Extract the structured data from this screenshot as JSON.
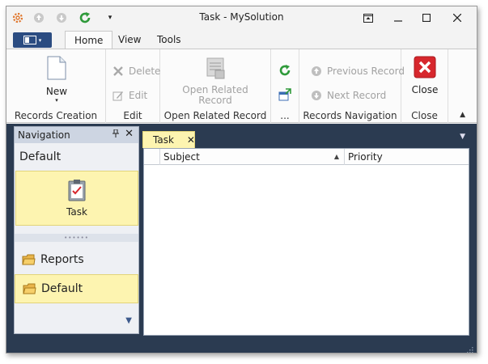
{
  "window": {
    "title": "Task - MySolution"
  },
  "quick_access": [
    "gear-icon",
    "up-circle-icon",
    "down-circle-icon",
    "refresh-icon",
    "customize-icon"
  ],
  "ribbon_tabs": [
    "Home",
    "View",
    "Tools"
  ],
  "ribbon": {
    "records_creation": {
      "label": "Records Creation",
      "new_label": "New"
    },
    "edit": {
      "label": "Edit",
      "delete_label": "Delete",
      "edit_label": "Edit"
    },
    "open_related": {
      "label": "Open Related Record",
      "button_line1": "Open Related",
      "button_line2": "Record"
    },
    "misc": {
      "label": "..."
    },
    "records_navigation": {
      "label": "Records Navigation",
      "previous_label": "Previous Record",
      "next_label": "Next Record"
    },
    "close": {
      "label": "Close",
      "button_label": "Close"
    }
  },
  "navigation": {
    "header": "Navigation",
    "group_title": "Default",
    "big_item": "Task",
    "items": [
      {
        "label": "Reports",
        "selected": false
      },
      {
        "label": "Default",
        "selected": true
      }
    ]
  },
  "document_tab": {
    "label": "Task"
  },
  "grid": {
    "columns": [
      "Subject",
      "Priority"
    ],
    "sorted_column": "Subject",
    "rows": []
  },
  "colors": {
    "workspace": "#2b3b51",
    "highlight": "#fdf4b0",
    "app_button": "#2b4c81",
    "close_red": "#d7272d",
    "refresh_green": "#2f9a3a"
  }
}
